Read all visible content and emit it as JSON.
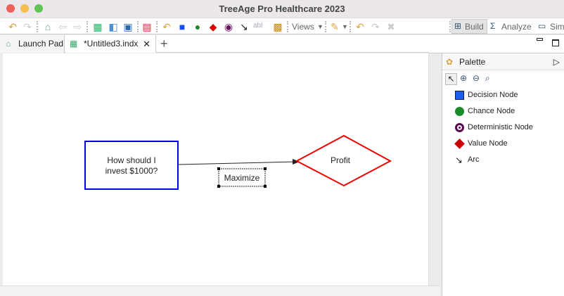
{
  "window": {
    "title": "TreeAge Pro Healthcare 2023"
  },
  "toolbar": {
    "views_label": "Views",
    "build_label": "Build",
    "analyze_label": "Analyze",
    "sim_label": "Sim",
    "text_tool_label": "abl"
  },
  "tabs": [
    {
      "label": "Launch Pad"
    },
    {
      "label": "*Untitled3.indx"
    }
  ],
  "diagram": {
    "decision_node": {
      "text_line1": "How should I",
      "text_line2": "invest $1000?",
      "color": "#0000ee"
    },
    "value_node": {
      "text": "Profit",
      "color": "#ee0000"
    },
    "arc_label": "Maximize"
  },
  "palette": {
    "title": "Palette",
    "items": [
      {
        "label": "Decision Node",
        "icon": "blue-square"
      },
      {
        "label": "Chance Node",
        "icon": "green-circle"
      },
      {
        "label": "Deterministic Node",
        "icon": "purple-ring"
      },
      {
        "label": "Value Node",
        "icon": "red-diamond"
      },
      {
        "label": "Arc",
        "icon": "arrow"
      }
    ]
  }
}
